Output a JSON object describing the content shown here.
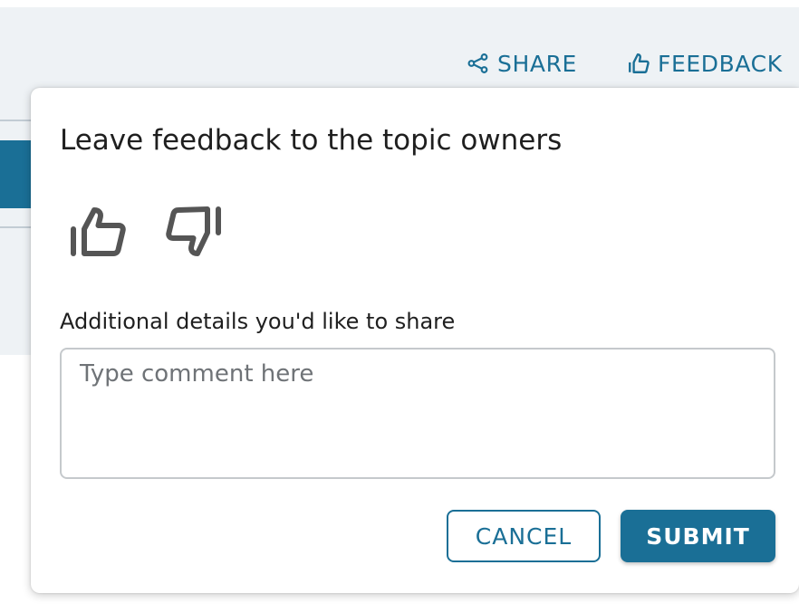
{
  "header": {
    "share_label": "SHARE",
    "feedback_label": "FEEDBACK",
    "share_icon": "share-icon",
    "feedback_icon": "thumb-up-icon"
  },
  "feedback_dialog": {
    "title": "Leave feedback to the topic owners",
    "rating_options": [
      "thumb-up-icon",
      "thumb-down-icon"
    ],
    "details_label": "Additional details you'd like to share",
    "comment_value": "",
    "comment_placeholder": "Type comment here",
    "cancel_label": "CANCEL",
    "submit_label": "SUBMIT"
  },
  "colors": {
    "accent": "#1a6f96",
    "background_page": "#eef2f5",
    "text": "#1f1f1f",
    "placeholder": "#6f7377",
    "input_border": "#c5c9cc",
    "icon_gray": "#555555"
  }
}
